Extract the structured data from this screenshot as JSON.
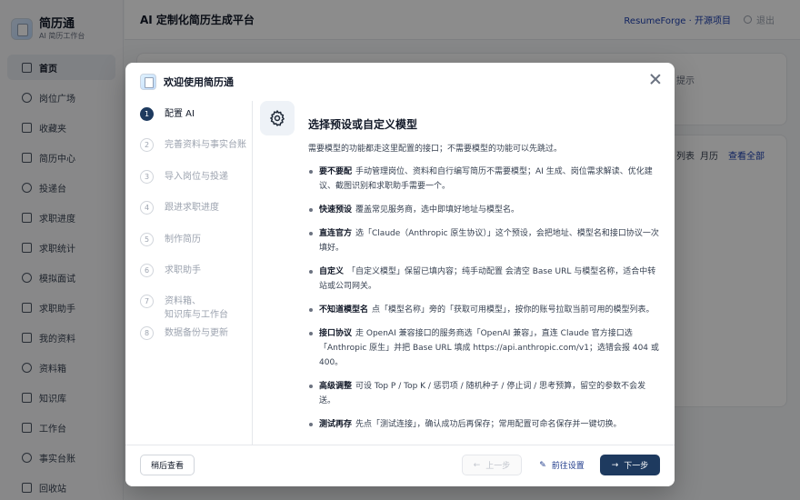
{
  "brand": {
    "name": "简历通",
    "sub": "AI 简历工作台"
  },
  "sidebar": {
    "items": [
      {
        "label": "首页",
        "icon": "home-icon",
        "active": true
      },
      {
        "label": "岗位广场",
        "icon": "search-icon"
      },
      {
        "label": "收藏夹",
        "icon": "star-icon"
      },
      {
        "label": "简历中心",
        "icon": "document-icon"
      },
      {
        "label": "投递台",
        "icon": "send-icon"
      },
      {
        "label": "求职进度",
        "icon": "progress-icon"
      },
      {
        "label": "求职统计",
        "icon": "chart-icon"
      },
      {
        "label": "模拟面试",
        "icon": "interview-icon"
      },
      {
        "label": "求职助手",
        "icon": "chat-icon"
      },
      {
        "label": "我的资料",
        "icon": "user-icon"
      },
      {
        "label": "资料箱",
        "icon": "box-icon"
      },
      {
        "label": "知识库",
        "icon": "book-icon"
      },
      {
        "label": "工作台",
        "icon": "tool-icon"
      },
      {
        "label": "事实台账",
        "icon": "ledger-icon"
      },
      {
        "label": "回收站",
        "icon": "trash-icon"
      }
    ]
  },
  "header": {
    "title": "AI 定制化简历生成平台",
    "project_link": "ResumeForge · 开源项目",
    "logout": "退出"
  },
  "background": {
    "hint": "提示",
    "tab_list": "列表",
    "tab_month": "月历",
    "view_all": "查看全部"
  },
  "modal": {
    "title": "欢迎使用简历通",
    "steps": [
      {
        "num": "1",
        "label": "配置 AI",
        "active": true
      },
      {
        "num": "2",
        "label": "完善资料与事实台账"
      },
      {
        "num": "3",
        "label": "导入岗位与投递"
      },
      {
        "num": "4",
        "label": "跟进求职进度"
      },
      {
        "num": "5",
        "label": "制作简历"
      },
      {
        "num": "6",
        "label": "求职助手"
      },
      {
        "num": "7",
        "label": "资料箱、\n知识库与工作台"
      },
      {
        "num": "8",
        "label": "数据备份与更新"
      }
    ],
    "content": {
      "title": "选择预设或自定义模型",
      "intro": "需要模型的功能都走这里配置的接口；不需要模型的功能可以先跳过。",
      "bullets": [
        {
          "head": "要不要配",
          "text": "手动管理岗位、资料和自行编写简历不需要模型；AI 生成、岗位需求解读、优化建议、截图识别和求职助手需要一个。"
        },
        {
          "head": "快速预设",
          "text": "覆盖常见服务商，选中即填好地址与模型名。"
        },
        {
          "head": "直连官方",
          "text": "选「Claude（Anthropic 原生协议）」这个预设，会把地址、模型名和接口协议一次填好。"
        },
        {
          "head": "自定义",
          "text": "「自定义模型」保留已填内容；纯手动配置 会清空 Base URL 与模型名称，适合中转站或公司网关。"
        },
        {
          "head": "不知道模型名",
          "text": "点「模型名称」旁的「获取可用模型」，按你的账号拉取当前可用的模型列表。"
        },
        {
          "head": "接口协议",
          "text": "走 OpenAI 兼容接口的服务商选「OpenAI 兼容」，直连 Claude 官方接口选「Anthropic 原生」并把 Base URL 填成 https://api.anthropic.com/v1；选错会报 404 或 400。"
        },
        {
          "head": "高级调整",
          "text": "可设 Top P / Top K / 惩罚项 / 随机种子 / 停止词 / 思考预算，留空的参数不会发送。"
        },
        {
          "head": "测试再存",
          "text": "先点「测试连接」，确认成功后再保存；常用配置可命名保存并一键切换。"
        }
      ]
    },
    "footer": {
      "later": "稍后查看",
      "prev": "上一步",
      "settings": "前往设置",
      "next": "下一步"
    }
  }
}
